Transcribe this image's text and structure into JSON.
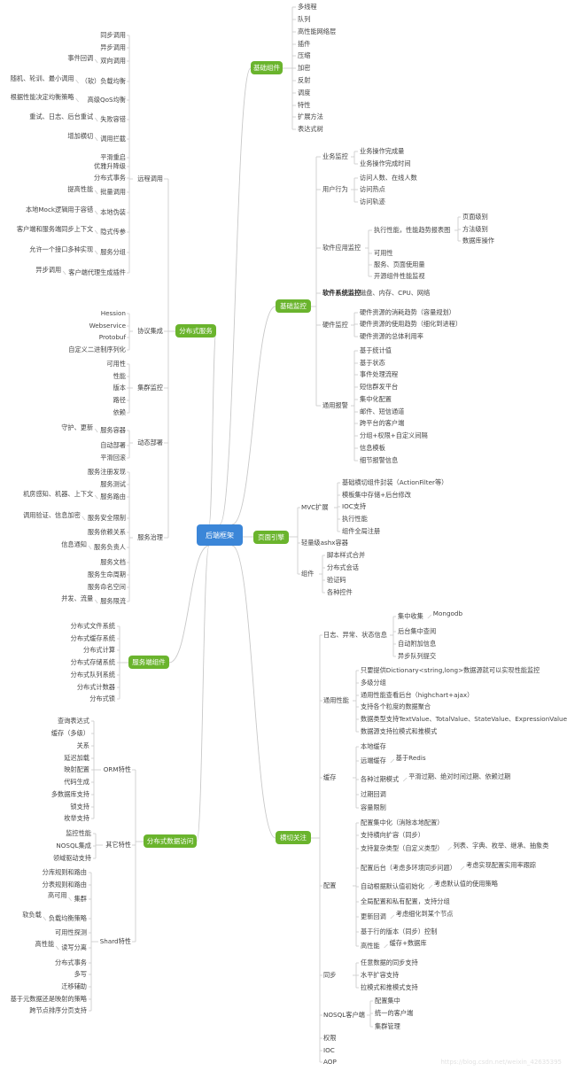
{
  "root": {
    "label": "后端框架"
  },
  "colors": {
    "root": "#3b86d8",
    "branch": "#6ab42d",
    "line": "#c8c8c8",
    "text": "#444444"
  },
  "branches": {
    "basic_components": {
      "label": "基础组件",
      "items": [
        "多线程",
        "队列",
        "高性能网络层",
        "插件",
        "压缩",
        "加密",
        "反射",
        "调度",
        "特性",
        "扩展方法",
        "表达式树"
      ]
    },
    "basic_monitoring": {
      "label": "基础监控",
      "groups": [
        {
          "label": "业务监控",
          "items": [
            "业务操作完成量",
            "业务操作完成时间"
          ]
        },
        {
          "label": "用户行为",
          "items": [
            "访问人数、在线人数",
            "访问热点",
            "访问轨迹"
          ]
        },
        {
          "label": "软件应用监控",
          "items": [
            {
              "label": "执行性能，性能趋势报表图",
              "items": [
                "页面级别",
                "方法级别",
                "数据库操作"
              ]
            },
            "可用性",
            "服务、页面使用量",
            "开源组件性能监视"
          ]
        },
        {
          "label": "软件系统监控",
          "items": [
            "磁盘、内存、CPU、网络"
          ]
        },
        {
          "label": "硬件监控",
          "items": [
            "硬件资源的消耗趋势（容量规划）",
            "硬件资源的使用趋势（细化到进程）",
            "硬件资源的总体利用率"
          ]
        },
        {
          "label": "通用报警",
          "items": [
            "基于统计值",
            "基于状态",
            "事件处理流程",
            "短信群发平台",
            "集中化配置",
            "邮件、短信通道",
            "跨平台的客户端",
            "分组+权限+自定义间隔",
            "信息模板",
            "细节报警信息"
          ]
        }
      ]
    },
    "page_engine": {
      "label": "页面引擎",
      "groups": [
        {
          "label": "MVC扩展",
          "items": [
            "基础横切组件封装（ActionFilter等）",
            "模板集中存储+后台修改",
            "IOC支持",
            "执行性能",
            "组件全局注册"
          ]
        },
        {
          "label": "轻量级ashx容器",
          "items": []
        },
        {
          "label": "组件",
          "items": [
            "脚本样式合并",
            "分布式会话",
            "验证码",
            "各种控件"
          ]
        }
      ]
    },
    "cross_cutting": {
      "label": "横切关注",
      "groups": [
        {
          "label": "日志、异常、状态信息",
          "items": [
            {
              "label": "集中收集",
              "note": "Mongodb"
            },
            "后台集中查阅",
            "自动附加信息",
            "异步队列提交"
          ]
        },
        {
          "label": "通用性能",
          "items": [
            "只要提供Dictionary<string,long>数据源就可以实现性能监控",
            "多级分组",
            "通用性能查看后台（highchart+ajax）",
            "支持各个粒度的数据聚合",
            "数据类型支持TextValue、TotalValue、StateValue、ExpressionValue",
            "数据源支持拉模式和推模式"
          ]
        },
        {
          "label": "缓存",
          "items": [
            "本地缓存",
            {
              "label": "远端缓存",
              "note": "基于Redis"
            },
            {
              "label": "各种过期模式",
              "note": "平滑过期、绝对时间过期、依赖过期"
            },
            "过期回调",
            "容量限制"
          ]
        },
        {
          "label": "配置",
          "items": [
            "配置集中化（消除本地配置）",
            "支持横向扩容（同步）",
            {
              "label": "支持复杂类型（自定义类型）",
              "note": "列表、字典、枚举、继承、抽象类"
            },
            {
              "label": "配置后台（考虑多环境同步问题）",
              "note": "考虑实现配置实用率跟踪"
            },
            {
              "label": "自动根据默认值初始化",
              "note": "考虑默认值的使用策略"
            },
            "全局配置和私有配置，支持分组",
            {
              "label": "更新回调",
              "note": "考虑细化到某个节点"
            },
            "基于行的版本（同步）控制",
            {
              "label": "高性能",
              "note": "缓存+数据库"
            }
          ]
        },
        {
          "label": "同步",
          "items": [
            "任意数据的同步支持",
            "水平扩容支持",
            "拉模式和推模式支持"
          ]
        },
        {
          "label": "NOSQL客户端",
          "items": [
            "配置集中",
            "统一的客户端",
            "集群管理"
          ]
        },
        {
          "label": "权限",
          "items": []
        },
        {
          "label": "IOC",
          "items": []
        },
        {
          "label": "AOP",
          "items": []
        }
      ]
    },
    "distributed_service": {
      "label": "分布式服务",
      "groups": [
        {
          "label": "远程调用",
          "items": [
            "同步调用",
            "异步调用",
            {
              "label": "双向调用",
              "note": "事件回调"
            },
            {
              "label": "（软）负载均衡",
              "note": "随机、轮训、最小调用"
            },
            {
              "label": "高级QoS均衡",
              "note": "根据性能决定均衡策略"
            },
            {
              "label": "失败容错",
              "note": "重试、日志、后台重试"
            },
            {
              "label": "调用拦截",
              "note": "增加横切"
            },
            "平滑重启",
            "优雅升降级",
            "分布式事务",
            {
              "label": "批量调用",
              "note": "提高性能"
            },
            {
              "label": "本地伪装",
              "note": "本地Mock逻辑用于容错"
            },
            {
              "label": "隐式传参",
              "note": "客户端和服务端同步上下文"
            },
            {
              "label": "服务分组",
              "note": "允许一个接口多种实现"
            },
            {
              "label": "客户端代理生成插件",
              "note": "异步调用"
            }
          ]
        },
        {
          "label": "协议集成",
          "items": [
            "Hession",
            "Webservice",
            "Protobuf",
            "自定义二进制序列化"
          ]
        },
        {
          "label": "集群监控",
          "items": [
            "可用性",
            "性能",
            "版本",
            "路径",
            "依赖"
          ]
        },
        {
          "label": "动态部署",
          "items": [
            {
              "label": "服务容器",
              "note": "守护、更新"
            },
            "自动部署",
            "平滑回滚"
          ]
        },
        {
          "label": "服务治理",
          "items": [
            "服务注册发现",
            "服务测试",
            {
              "label": "服务路由",
              "note": "机房感知、机器、上下文"
            },
            {
              "label": "服务安全限制",
              "note": "调用验证、信息加密"
            },
            "服务依赖关系",
            {
              "label": "服务负责人",
              "note": "信息通知"
            },
            "服务文档",
            "服务生命周期",
            "服务命名空间",
            {
              "label": "服务限流",
              "note": "并发、流量"
            }
          ]
        }
      ]
    },
    "server_components": {
      "label": "服务端组件",
      "items": [
        "分布式文件系统",
        "分布式缓存系统",
        "分布式计算",
        "分布式存储系统",
        "分布式队列系统",
        "分布式计数器",
        "分布式锁"
      ]
    },
    "distributed_data_access": {
      "label": "分布式数据访问",
      "groups": [
        {
          "label": "ORM特性",
          "items": [
            "查询表达式",
            "缓存（多级）",
            "关系",
            "延迟加载",
            "映射配置",
            "代码生成",
            "多数据库支持",
            "锁支持",
            "枚举支持"
          ]
        },
        {
          "label": "其它特性",
          "items": [
            "监控性能",
            "NOSQL集成",
            "领域驱动支持"
          ]
        },
        {
          "label": "Shard特性",
          "items": [
            "分库规则和路由",
            "分表规则和路由",
            {
              "label": "集群",
              "note": "高可用"
            },
            {
              "label": "负载均衡策略",
              "note": "软负载"
            },
            "可用性探测",
            {
              "label": "读写分离",
              "note": "高性能"
            },
            "分布式事务",
            "多写",
            "迁移辅助",
            "基于元数据还是映射的策略",
            "跨节点排序分页支持"
          ]
        }
      ]
    }
  },
  "watermark": "https://blog.csdn.net/weixin_42635395"
}
